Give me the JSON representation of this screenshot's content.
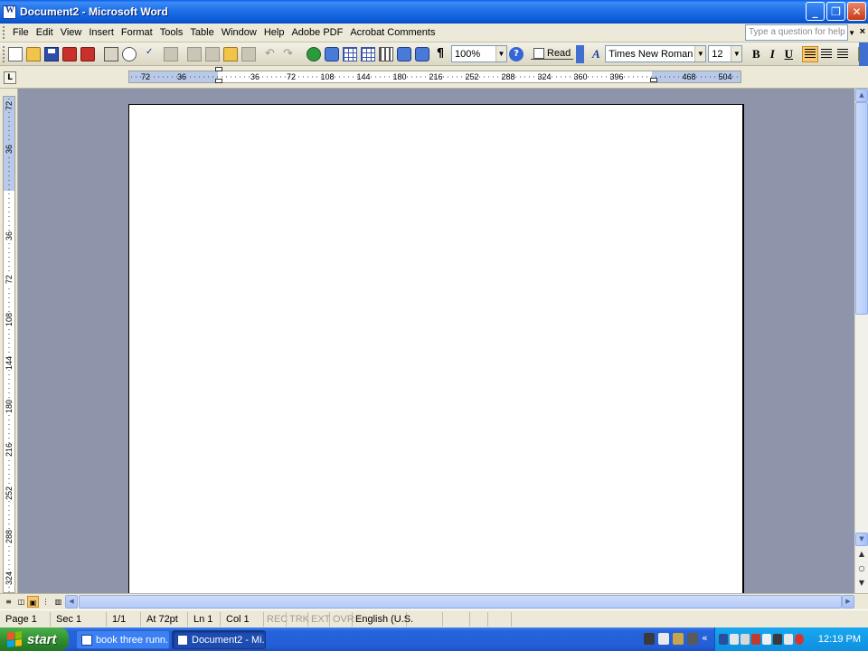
{
  "window": {
    "title": "Document2 - Microsoft Word"
  },
  "menu": {
    "items": [
      "File",
      "Edit",
      "View",
      "Insert",
      "Format",
      "Tools",
      "Table",
      "Window",
      "Help",
      "Adobe PDF",
      "Acrobat Comments"
    ],
    "help_placeholder": "Type a question for help"
  },
  "toolbar": {
    "zoom": "100%",
    "read_label": "Read",
    "font_name": "Times New Roman",
    "font_size": "12",
    "bold": "B",
    "italic": "I",
    "underline": "U"
  },
  "ruler": {
    "horizontal_ticks": [
      "72",
      "36",
      "36",
      "72",
      "108",
      "144",
      "180",
      "216",
      "252",
      "288",
      "324",
      "360",
      "396",
      "468",
      "504"
    ],
    "vertical_ticks": [
      "72",
      "36",
      "36",
      "72",
      "108",
      "144",
      "180",
      "216",
      "252",
      "288",
      "324"
    ],
    "tab_selector": "L"
  },
  "statusbar": {
    "page": "Page 1",
    "section": "Sec 1",
    "page_count": "1/1",
    "at": "At 72pt",
    "line": "Ln 1",
    "col": "Col 1",
    "rec": "REC",
    "trk": "TRK",
    "ext": "EXT",
    "ovr": "OVR",
    "language": "English (U.S."
  },
  "taskbar": {
    "start_label": "start",
    "tasks": [
      {
        "label": "book three runn..."
      },
      {
        "label": "Document2 - Mi..."
      }
    ],
    "clock": "12:19 PM"
  },
  "colors": {
    "titlebar": "#0a58d6",
    "workspace": "#8e95aa",
    "taskbar": "#245ed6",
    "start": "#2f8a2f"
  }
}
